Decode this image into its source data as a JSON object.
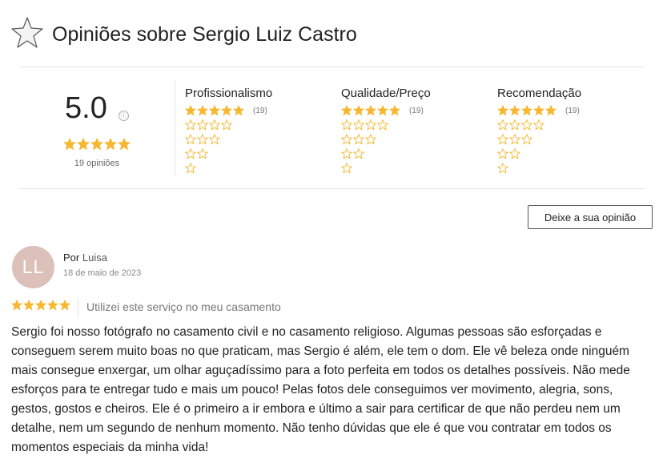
{
  "header": {
    "title": "Opiniões sobre Sergio Luiz Castro",
    "icon": "star-outline-icon"
  },
  "summary": {
    "score": "5.0",
    "info_icon": "ⓘ",
    "stars": 5,
    "count_label": "19 opiniões"
  },
  "categories": [
    {
      "title": "Profissionalismo",
      "rating": 5,
      "count": "(19)"
    },
    {
      "title": "Qualidade/Preço",
      "rating": 5,
      "count": "(19)"
    },
    {
      "title": "Recomendação",
      "rating": 5,
      "count": "(19)"
    }
  ],
  "button": {
    "label": "Deixe a sua opinião"
  },
  "review": {
    "avatar_initials": "LL",
    "author_prefix": "Por",
    "author_name": "Luisa",
    "date": "18 de maio de 2023",
    "stars": 5,
    "service": "Utilizei este serviço no meu casamento",
    "text": "Sergio foi nosso fotógrafo no casamento civil e no casamento religioso. Algumas pessoas são esforçadas e conseguem serem muito boas no que praticam, mas Sergio é além, ele tem o dom. Ele vê beleza onde ninguém mais consegue enxergar, um olhar aguçadíssimo para a foto perfeita em todos os detalhes possíveis. Não mede esforços para te entregar tudo e mais um pouco! Pelas fotos dele conseguimos ver movimento, alegria, sons, gestos, gostos e cheiros. Ele é o primeiro a ir embora e último a sair para certificar de que não perdeu nem um detalhe, nem um segundo de nenhum momento. Não tenho dúvidas que ele é que vou contratar em todos os momentos especiais da minha vida!"
  },
  "colors": {
    "star_filled": "#f7b731",
    "star_outline": "#f7b731",
    "avatar_bg": "#dbc1ba"
  }
}
